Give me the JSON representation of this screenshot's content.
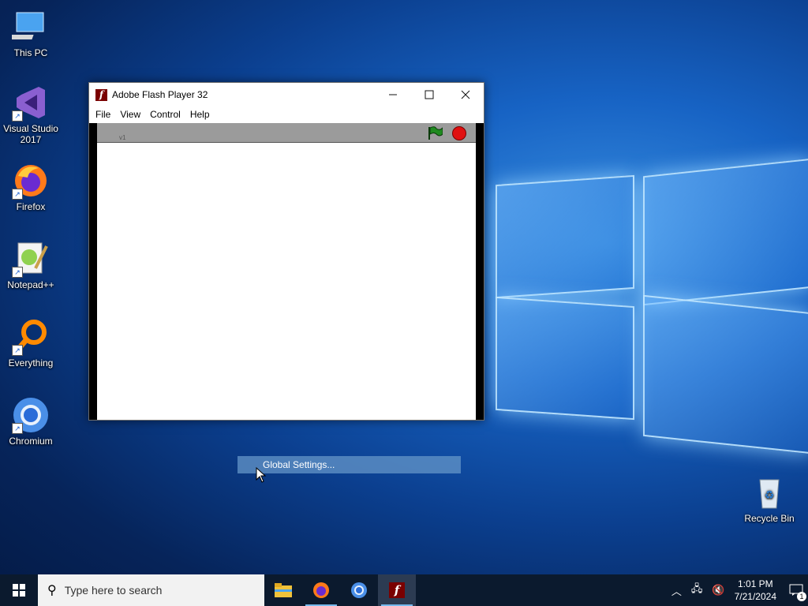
{
  "desktop": {
    "icons": [
      {
        "label": "This PC"
      },
      {
        "label": "Visual Studio 2017"
      },
      {
        "label": "Firefox"
      },
      {
        "label": "Notepad++"
      },
      {
        "label": "Everything"
      },
      {
        "label": "Chromium"
      },
      {
        "label": "Recycle Bin"
      }
    ]
  },
  "window": {
    "title": "Adobe Flash Player 32",
    "menu": [
      "File",
      "View",
      "Control",
      "Help"
    ],
    "stage_faint_text": "v1"
  },
  "context_menu": {
    "item": "Global Settings..."
  },
  "taskbar": {
    "search_placeholder": "Type here to search",
    "time": "1:01 PM",
    "date": "7/21/2024",
    "notification_count": "1"
  },
  "colors": {
    "flash_red": "#7a0000",
    "stop_red": "#e01010",
    "flag_green": "#1f8a1f",
    "taskbar": "#0b1a2e"
  }
}
